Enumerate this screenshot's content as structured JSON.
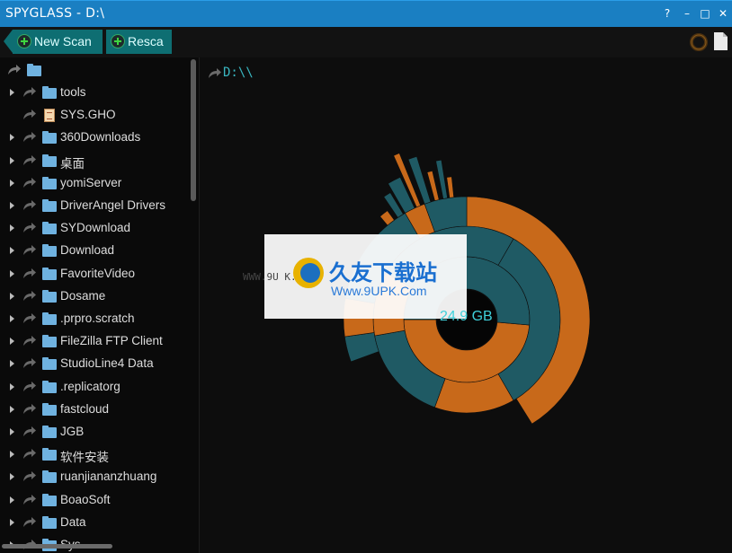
{
  "window": {
    "title": "SPYGLASS - D:\\",
    "help": "?",
    "minimize": "–",
    "maximize": "□",
    "close": "✕"
  },
  "toolbar": {
    "new_scan_label": "New Scan",
    "rescan_label": "Resca"
  },
  "main": {
    "path": "D:\\\\",
    "center_size": "24.9 GB"
  },
  "watermark": {
    "url_text": "WWW.9U K.com",
    "site_name": "久友下载站",
    "site_url": "Www.9UPK.Com"
  },
  "tree": {
    "items": [
      {
        "label": "tools",
        "type": "folder"
      },
      {
        "label": "SYS.GHO",
        "type": "file"
      },
      {
        "label": "360Downloads",
        "type": "folder"
      },
      {
        "label": "桌面",
        "type": "folder"
      },
      {
        "label": "yomiServer",
        "type": "folder"
      },
      {
        "label": "DriverAngel Drivers",
        "type": "folder"
      },
      {
        "label": "SYDownload",
        "type": "folder"
      },
      {
        "label": "Download",
        "type": "folder"
      },
      {
        "label": "FavoriteVideo",
        "type": "folder"
      },
      {
        "label": "Dosame",
        "type": "folder"
      },
      {
        "label": ".prpro.scratch",
        "type": "folder"
      },
      {
        "label": "FileZilla FTP Client",
        "type": "folder"
      },
      {
        "label": "StudioLine4 Data",
        "type": "folder"
      },
      {
        "label": ".replicatorg",
        "type": "folder"
      },
      {
        "label": "fastcloud",
        "type": "folder"
      },
      {
        "label": "JGB",
        "type": "folder"
      },
      {
        "label": "软件安装",
        "type": "folder"
      },
      {
        "label": "ruanjiananzhuang",
        "type": "folder"
      },
      {
        "label": "BoaoSoft",
        "type": "folder"
      },
      {
        "label": "Data",
        "type": "folder"
      },
      {
        "label": "Sys",
        "type": "folder"
      }
    ]
  },
  "colors": {
    "titlebar": "#1a7fc2",
    "accent_teal": "#0e6e72",
    "ring_orange": "#c8691a",
    "ring_teal": "#1f5a64",
    "path_text": "#39b6c0"
  }
}
